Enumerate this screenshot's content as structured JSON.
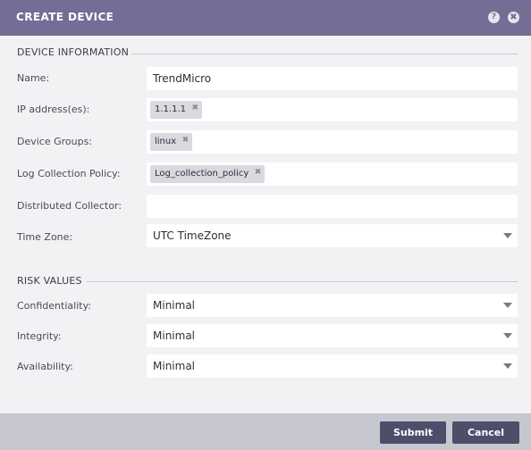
{
  "dialog": {
    "title": "CREATE DEVICE",
    "help_glyph": "?",
    "close_glyph": "✖"
  },
  "device_information": {
    "heading": "DEVICE INFORMATION",
    "name": {
      "label": "Name:",
      "value": "TrendMicro"
    },
    "ip": {
      "label": "IP address(es):",
      "tags": [
        "1.1.1.1"
      ]
    },
    "groups": {
      "label": "Device Groups:",
      "tags": [
        "linux"
      ]
    },
    "log_policy": {
      "label": "Log Collection Policy:",
      "tags": [
        "Log_collection_policy"
      ]
    },
    "collector": {
      "label": "Distributed Collector:",
      "value": ""
    },
    "timezone": {
      "label": "Time Zone:",
      "value": "UTC TimeZone"
    }
  },
  "risk_values": {
    "heading": "RISK VALUES",
    "confidentiality": {
      "label": "Confidentiality:",
      "value": "Minimal"
    },
    "integrity": {
      "label": "Integrity:",
      "value": "Minimal"
    },
    "availability": {
      "label": "Availability:",
      "value": "Minimal"
    }
  },
  "tag_remove_glyph": "✖",
  "footer": {
    "submit_label": "Submit",
    "cancel_label": "Cancel"
  },
  "colors": {
    "titlebar": "#736e95",
    "button": "#4e4d6a",
    "footer": "#c7c7cf"
  }
}
